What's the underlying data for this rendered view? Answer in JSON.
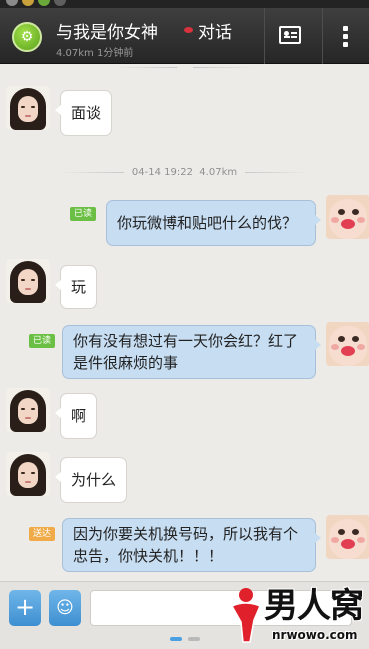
{
  "header": {
    "contact_name": "与我是你女神",
    "chat_label": "对话",
    "subtitle": "4.07km 1分钟前",
    "card_icon": "contact-card-icon",
    "more_icon": "more-vertical-icon",
    "app_icon": "bike-icon"
  },
  "timestamps": [
    {
      "date": "04-14 19:22",
      "distance": "4.07km"
    }
  ],
  "messages": [
    {
      "from": "her",
      "text": "面谈"
    },
    {
      "from": "me",
      "text": "你玩微博和贴吧什么的伐？",
      "status": "已读"
    },
    {
      "from": "her",
      "text": "玩"
    },
    {
      "from": "me",
      "text": "你有没有想过有一天你会红？红了是件很麻烦的事",
      "status": "已读"
    },
    {
      "from": "her",
      "text": "啊"
    },
    {
      "from": "her",
      "text": "为什么"
    },
    {
      "from": "me",
      "text": "因为你要关机换号码，所以我有个忠告，你快关机！！！",
      "status": "送达"
    }
  ],
  "input_bar": {
    "plus_label": "+",
    "emoji_label": "☺",
    "input_value": ""
  },
  "watermark": {
    "title": "男人窝",
    "url": "nrwowo.com"
  },
  "colors": {
    "read_tag": "#6cbf45",
    "sent_tag": "#f0ab48",
    "outgoing_bubble": "#c7ddf2",
    "incoming_bubble": "#ffffff",
    "header": "#2e2e2e"
  }
}
